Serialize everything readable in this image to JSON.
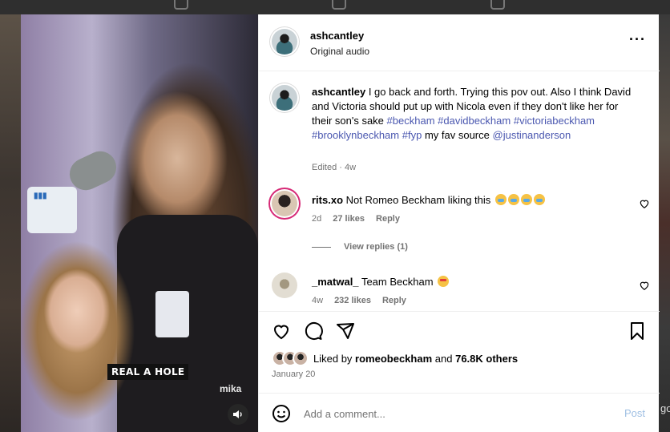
{
  "post": {
    "username": "ashcantley",
    "audio": "Original audio",
    "caption_username": "ashcantley",
    "caption_plain": "I go back and forth. Trying this pov out. Also I think David and Victoria should put up with Nicola even if they don't like her for their son's sake",
    "caption_tags": [
      "#beckham",
      "#davidbeckham",
      "#victoriabeckham",
      "#brooklynbeckham",
      "#fyp"
    ],
    "caption_tail": "my fav source",
    "caption_mention": "@justinanderson",
    "edited_meta": "Edited · 4w",
    "video_caption": "REAL A HOLE",
    "video_brand": "mika"
  },
  "comments": [
    {
      "username": "rits.xo",
      "text": "Not Romeo Beckham liking this",
      "emoji": [
        "crying-face",
        "crying-face",
        "crying-face",
        "crying-face"
      ],
      "age": "2d",
      "likes": "27 likes",
      "reply": "Reply"
    },
    {
      "username": "_matwal_",
      "text": "Team Beckham",
      "emoji": [
        "star-struck"
      ],
      "age": "4w",
      "likes": "232 likes",
      "reply": "Reply"
    }
  ],
  "view_replies": "View replies (1)",
  "likes": {
    "prefix": "Liked by",
    "user": "romeobeckham",
    "and": "and",
    "others": "76.8K others"
  },
  "date": "January 20",
  "comment_box": {
    "placeholder": "Add a comment...",
    "post_label": "Post"
  },
  "background": {
    "right_edge_text": "go"
  },
  "colors": {
    "link": "#4b58b0",
    "muted": "#737373",
    "post_disabled": "#9fbfe3"
  },
  "icons": [
    "heart-icon",
    "comment-icon",
    "share-icon",
    "bookmark-icon",
    "emoji-icon",
    "more-icon",
    "sound-icon"
  ]
}
